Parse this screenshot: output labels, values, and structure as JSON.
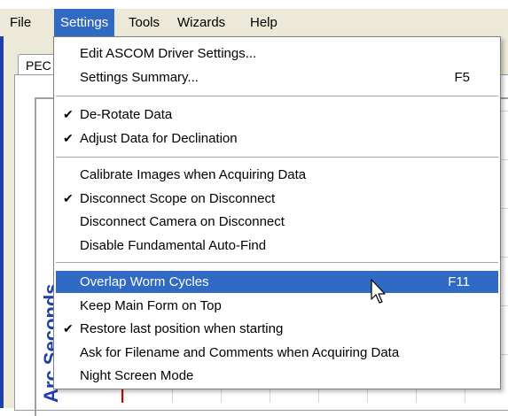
{
  "menubar": {
    "items": [
      "File",
      "Settings",
      "Tools",
      "Wizards",
      "Help"
    ]
  },
  "background": {
    "tab_label": "PEC",
    "axis_label": "Arc Seconds"
  },
  "settings_menu": {
    "items": [
      {
        "label": "Edit ASCOM Driver Settings...",
        "checked": false,
        "shortcut": ""
      },
      {
        "label": "Settings Summary...",
        "checked": false,
        "shortcut": "F5"
      },
      {
        "label": "De-Rotate Data",
        "checked": true,
        "shortcut": ""
      },
      {
        "label": "Adjust Data for Declination",
        "checked": true,
        "shortcut": ""
      },
      {
        "label": "Calibrate Images when Acquiring Data",
        "checked": false,
        "shortcut": ""
      },
      {
        "label": "Disconnect Scope on Disconnect",
        "checked": true,
        "shortcut": ""
      },
      {
        "label": "Disconnect Camera on Disconnect",
        "checked": false,
        "shortcut": ""
      },
      {
        "label": "Disable Fundamental Auto-Find",
        "checked": false,
        "shortcut": ""
      },
      {
        "label": "Overlap Worm Cycles",
        "checked": false,
        "shortcut": "F11",
        "highlighted": true
      },
      {
        "label": "Keep Main Form on Top",
        "checked": false,
        "shortcut": ""
      },
      {
        "label": "Restore last position when starting",
        "checked": true,
        "shortcut": ""
      },
      {
        "label": "Ask for Filename and Comments when Acquiring Data",
        "checked": false,
        "shortcut": ""
      },
      {
        "label": "Night Screen Mode",
        "checked": false,
        "shortcut": ""
      }
    ],
    "check_glyph": "✔"
  },
  "colors": {
    "highlight": "#316ac5",
    "menubar_bg": "#ece9d8",
    "axis_label": "#1e3fa8"
  }
}
